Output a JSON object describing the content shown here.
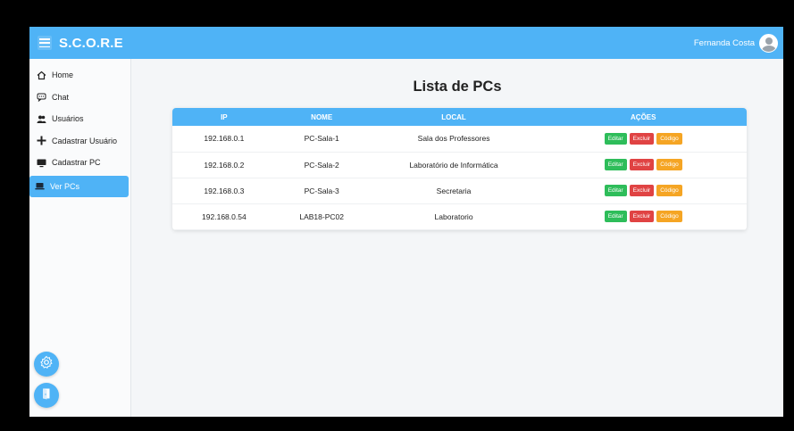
{
  "header": {
    "brand": "S.C.O.R.E",
    "user_name": "Fernanda Costa"
  },
  "sidebar": {
    "items": [
      {
        "label": "Home",
        "icon": "home-icon"
      },
      {
        "label": "Chat",
        "icon": "chat-icon"
      },
      {
        "label": "Usuários",
        "icon": "users-icon"
      },
      {
        "label": "Cadastrar Usuário",
        "icon": "add-icon"
      },
      {
        "label": "Cadastrar PC",
        "icon": "monitor-icon"
      },
      {
        "label": "Ver PCs",
        "icon": "laptop-icon",
        "active": true
      }
    ],
    "bottom_buttons": [
      "settings-icon",
      "logout-icon"
    ]
  },
  "main": {
    "title": "Lista de PCs",
    "columns": [
      "IP",
      "NOME",
      "LOCAL",
      "AÇÕES"
    ],
    "rows": [
      {
        "ip": "192.168.0.1",
        "name": "PC-Sala-1",
        "local": "Sala dos Professores"
      },
      {
        "ip": "192.168.0.2",
        "name": "PC-Sala-2",
        "local": "Laboratório de Informática"
      },
      {
        "ip": "192.168.0.3",
        "name": "PC-Sala-3",
        "local": "Secretaria"
      },
      {
        "ip": "192.168.0.54",
        "name": "LAB18-PC02",
        "local": "Laboratorio"
      }
    ],
    "actions": {
      "edit": "Editar",
      "delete": "Excluir",
      "code": "Código"
    }
  },
  "colors": {
    "accent": "#4fb3f6",
    "edit": "#2ebd5a",
    "delete": "#e04343",
    "code": "#f5a524"
  }
}
